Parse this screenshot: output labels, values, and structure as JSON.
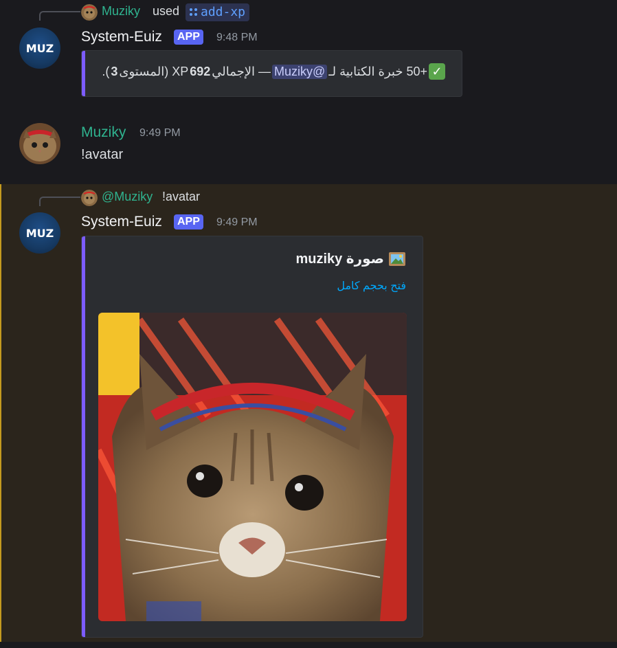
{
  "messages": [
    {
      "reply": {
        "name": "Muziky",
        "verb": "used",
        "command": "add-xp"
      },
      "author": "System-Euiz",
      "badge": "APP",
      "time": "9:48 PM",
      "embed": {
        "line_prefix": "+50 خبرة الكتابية لـ",
        "mention": "@Muziky",
        "line_mid": " — الإجمالي ",
        "total": "692",
        "line_xp": " XP (المستوى ",
        "level": "3",
        "line_end": ")."
      }
    },
    {
      "author": "Muziky",
      "time": "9:49 PM",
      "text": "!avatar"
    },
    {
      "reply": {
        "name": "@Muziky",
        "text": "!avatar"
      },
      "author": "System-Euiz",
      "badge": "APP",
      "time": "9:49 PM",
      "embed": {
        "title_icon": "picture-frame-icon",
        "title": "صورة muziky",
        "link": "فتح بحجم كامل",
        "image": "cat-avatar-image"
      }
    }
  ],
  "bot_avatar_text": "MUZ",
  "colors": {
    "background": "#1a1a1e",
    "highlight": "#2b251c",
    "accent": "#7c5cff",
    "username_green": "#2fb38f",
    "app_badge": "#5865f2",
    "link": "#00a8fc"
  }
}
